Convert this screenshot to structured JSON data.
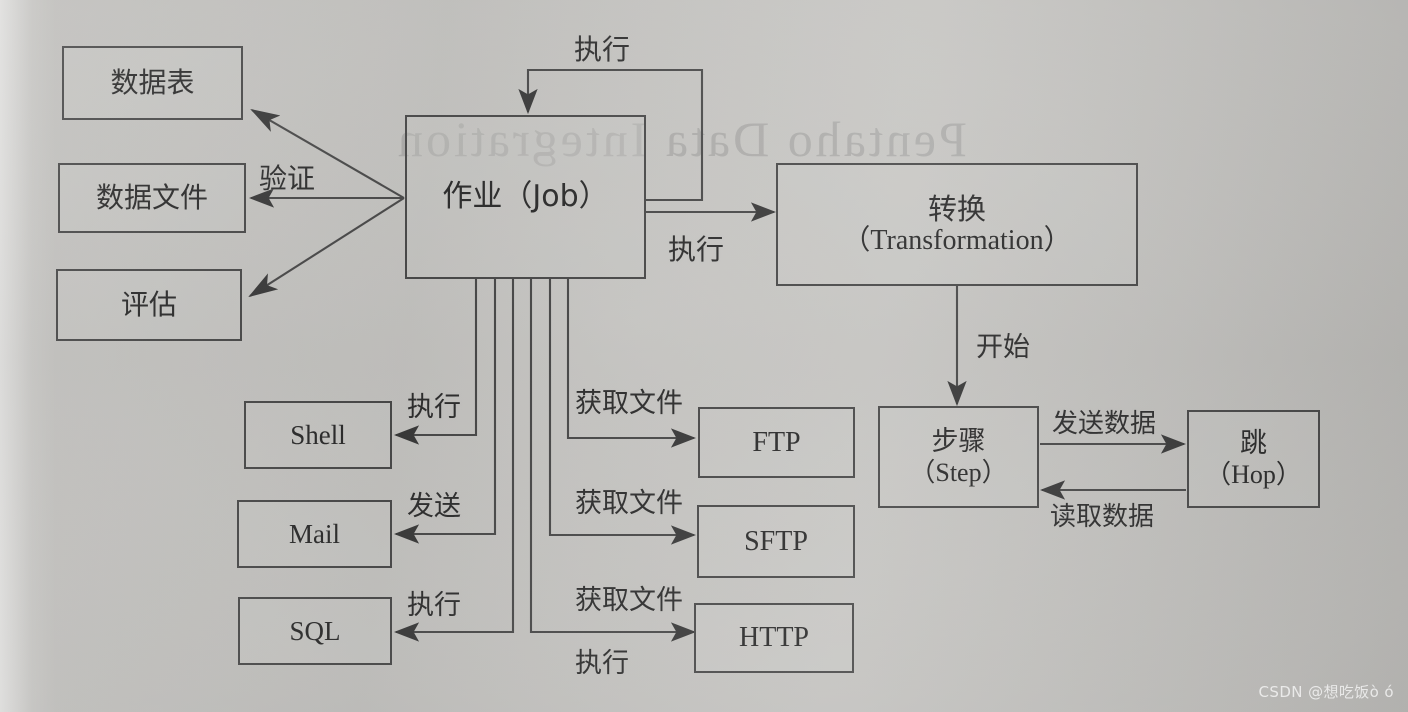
{
  "diagram": {
    "title_ghost": "Pentaho Data Integration",
    "watermark": "CSDN @想吃饭ò  ó",
    "ink_color": "#4a4a4a",
    "paper_color": "#c6c5c2",
    "nodes": {
      "data_table": {
        "label": "数据表"
      },
      "data_file": {
        "label": "数据文件"
      },
      "evaluation": {
        "label": "评估"
      },
      "job": {
        "label": "作业（Job）"
      },
      "transformation": {
        "line1": "转换",
        "line2": "（Transformation）"
      },
      "step": {
        "line1": "步骤",
        "line2": "（Step）"
      },
      "hop": {
        "line1": "跳",
        "line2": "（Hop）"
      },
      "shell": {
        "label": "Shell"
      },
      "mail": {
        "label": "Mail"
      },
      "sql": {
        "label": "SQL"
      },
      "ftp": {
        "label": "FTP"
      },
      "sftp": {
        "label": "SFTP"
      },
      "http": {
        "label": "HTTP"
      }
    },
    "edge_labels": {
      "job_self_execute": "执行",
      "job_validate": "验证",
      "job_to_transformation": "执行",
      "transformation_to_step": "开始",
      "step_to_hop": "发送数据",
      "hop_to_step": "读取数据",
      "job_to_shell": "执行",
      "job_to_mail": "发送",
      "job_to_sql": "执行",
      "job_to_ftp": "获取文件",
      "job_to_sftp": "获取文件",
      "job_to_http": "获取文件",
      "job_to_http_execute": "执行"
    }
  }
}
